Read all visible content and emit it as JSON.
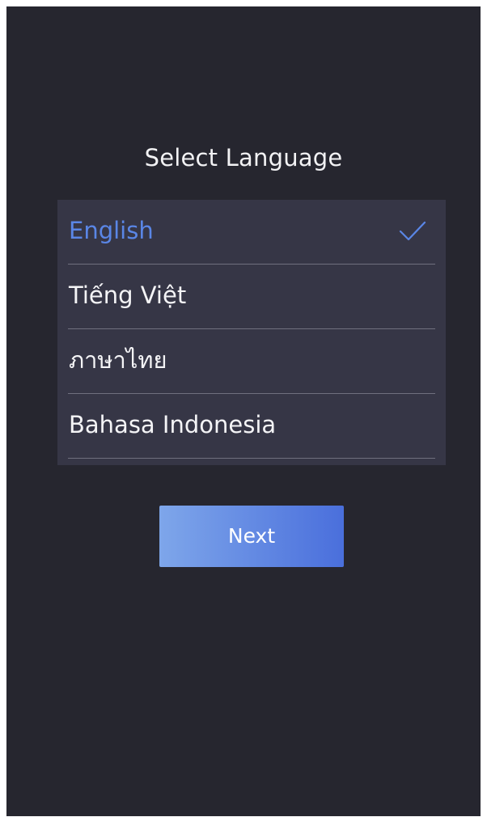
{
  "page_title": "Select Language",
  "languages": [
    {
      "label": "English",
      "selected": true
    },
    {
      "label": "Tiếng Việt",
      "selected": false
    },
    {
      "label": "ภาษาไทย",
      "selected": false
    },
    {
      "label": "Bahasa Indonesia",
      "selected": false
    }
  ],
  "next_button_label": "Next",
  "icons": {
    "selected_marker": "checkmark-icon"
  },
  "colors": {
    "background": "#26262f",
    "list_background": "#363646",
    "selected_text": "#5a86e6",
    "button_gradient_start": "#7ea6ea",
    "button_gradient_end": "#4a6fdc"
  }
}
